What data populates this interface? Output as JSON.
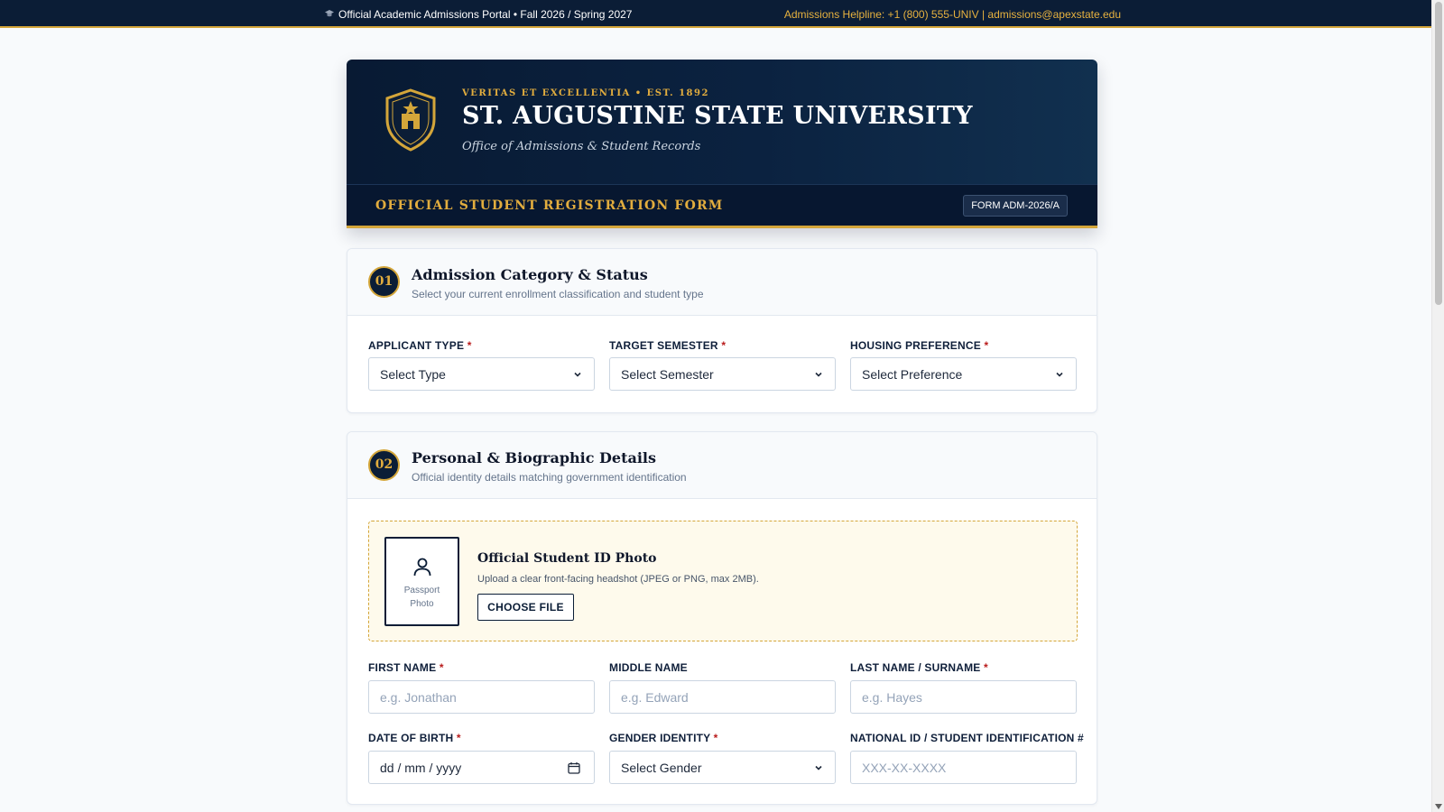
{
  "topbar": {
    "portal_text": "Official Academic Admissions Portal • Fall 2026 / Spring 2027",
    "contact_text": "Admissions Helpline: +1 (800) 555-UNIV | admissions@apexstate.edu"
  },
  "header": {
    "motto": "VERITAS ET EXCELLENTIA • EST. 1892",
    "university_name": "ST. AUGUSTINE STATE UNIVERSITY",
    "office": "Office of Admissions & Student Records",
    "form_title": "OFFICIAL STUDENT REGISTRATION FORM",
    "form_code": "FORM ADM-2026/A"
  },
  "colors": {
    "navy": "#0b1d36",
    "gold": "#d4a63a",
    "required": "#b91c1c"
  },
  "section1": {
    "number": "01",
    "title": "Admission Category & Status",
    "subtitle": "Select your current enrollment classification and student type",
    "fields": {
      "applicant_type": {
        "label": "APPLICANT TYPE",
        "required_mark": "*",
        "value": "Select Type"
      },
      "target_semester": {
        "label": "TARGET SEMESTER",
        "required_mark": "*",
        "value": "Select Semester"
      },
      "housing_preference": {
        "label": "HOUSING PREFERENCE",
        "required_mark": "*",
        "value": "Select Preference"
      }
    }
  },
  "section2": {
    "number": "02",
    "title": "Personal & Biographic Details",
    "subtitle": "Official identity details matching government identification",
    "photo": {
      "placeholder_line1": "Passport",
      "placeholder_line2": "Photo",
      "title": "Official Student ID Photo",
      "description": "Upload a clear front-facing headshot (JPEG or PNG, max 2MB).",
      "button_label": "CHOOSE FILE"
    },
    "fields": {
      "first_name": {
        "label": "FIRST NAME",
        "required_mark": "*",
        "placeholder": "e.g. Jonathan"
      },
      "middle_name": {
        "label": "MIDDLE NAME",
        "placeholder": "e.g. Edward"
      },
      "last_name": {
        "label": "LAST NAME / SURNAME",
        "required_mark": "*",
        "placeholder": "e.g. Hayes"
      },
      "date_of_birth": {
        "label": "DATE OF BIRTH",
        "required_mark": "*",
        "placeholder": "dd / mm / yyyy"
      },
      "gender_identity": {
        "label": "GENDER IDENTITY",
        "required_mark": "*",
        "value": "Select Gender"
      },
      "national_id": {
        "label": "NATIONAL ID / STUDENT IDENTIFICATION #",
        "placeholder": "XXX-XX-XXXX"
      }
    }
  },
  "icons": {
    "crest": "shield-crest-icon",
    "dropdown": "chevron-down-icon",
    "calendar": "calendar-icon",
    "person": "person-icon",
    "cap": "graduation-cap-icon"
  }
}
